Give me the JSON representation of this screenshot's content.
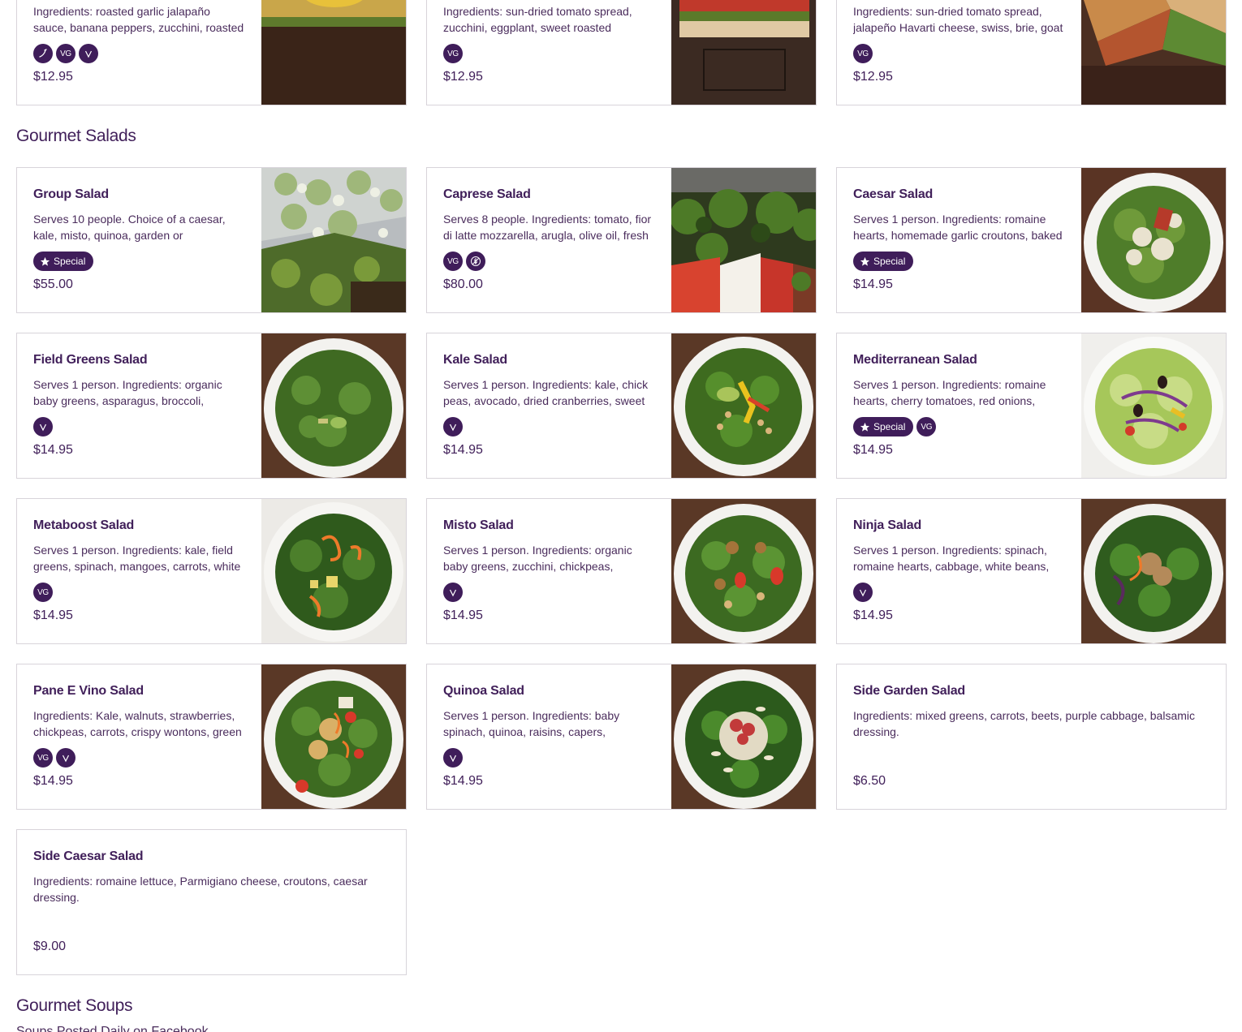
{
  "top_row": [
    {
      "desc": "Ingredients: roasted garlic jalapaño sauce, banana peppers, zucchini, roasted",
      "badges": [
        "spicy",
        "VG",
        "V"
      ],
      "price": "$12.95"
    },
    {
      "desc": "Ingredients: sun-dried tomato spread, zucchini, eggplant, sweet roasted",
      "badges": [
        "VG"
      ],
      "price": "$12.95"
    },
    {
      "desc": "Ingredients: sun-dried tomato spread, jalapeño Havarti cheese, swiss, brie, goat",
      "badges": [
        "VG"
      ],
      "price": "$12.95"
    }
  ],
  "salads_section": {
    "title": "Gourmet Salads",
    "items": [
      {
        "name": "Group Salad",
        "desc": "Serves 10 people. Choice of a caesar, kale, misto, quinoa, garden or",
        "special": "Special",
        "badges": [],
        "price": "$55.00",
        "image": "salad-trays"
      },
      {
        "name": "Caprese Salad",
        "desc": "Serves 8 people. Ingredients: tomato, fior di latte mozzarella, arugla, olive oil, fresh",
        "special": "",
        "badges": [
          "VG",
          "gluten-free"
        ],
        "price": "$80.00",
        "image": "caprese"
      },
      {
        "name": "Caesar Salad",
        "desc": "Serves 1 person. Ingredients: romaine hearts, homemade garlic croutons, baked",
        "special": "Special",
        "badges": [],
        "price": "$14.95",
        "image": "caesar"
      },
      {
        "name": "Field Greens Salad",
        "desc": "Serves 1 person. Ingredients: organic baby greens, asparagus, broccoli,",
        "special": "",
        "badges": [
          "V"
        ],
        "price": "$14.95",
        "image": "greens"
      },
      {
        "name": "Kale Salad",
        "desc": "Serves 1 person. Ingredients: kale, chick peas, avocado, dried cranberries, sweet",
        "special": "",
        "badges": [
          "V"
        ],
        "price": "$14.95",
        "image": "kale"
      },
      {
        "name": "Mediterranean Salad",
        "desc": "Serves 1 person. Ingredients: romaine hearts, cherry tomatoes, red onions,",
        "special": "Special",
        "badges": [
          "VG"
        ],
        "price": "$14.95",
        "image": "mediterranean"
      },
      {
        "name": "Metaboost Salad",
        "desc": "Serves 1 person. Ingredients: kale, field greens, spinach, mangoes, carrots, white",
        "special": "",
        "badges": [
          "VG"
        ],
        "price": "$14.95",
        "image": "metaboost"
      },
      {
        "name": "Misto Salad",
        "desc": "Serves 1 person. Ingredients: organic baby greens, zucchini, chickpeas,",
        "special": "",
        "badges": [
          "V"
        ],
        "price": "$14.95",
        "image": "misto"
      },
      {
        "name": "Ninja Salad",
        "desc": "Serves 1 person. Ingredients: spinach, romaine hearts, cabbage, white beans,",
        "special": "",
        "badges": [
          "V"
        ],
        "price": "$14.95",
        "image": "ninja"
      },
      {
        "name": "Pane E Vino Salad",
        "desc": "Ingredients: Kale, walnuts, strawberries, chickpeas, carrots, crispy wontons, green",
        "special": "",
        "badges": [
          "VG",
          "V"
        ],
        "price": "$14.95",
        "image": "panevino"
      },
      {
        "name": "Quinoa Salad",
        "desc": "Serves 1 person. Ingredients: baby spinach, quinoa, raisins, capers,",
        "special": "",
        "badges": [
          "V"
        ],
        "price": "$14.95",
        "image": "quinoa"
      },
      {
        "name": "Side Garden Salad",
        "desc": "Ingredients: mixed greens, carrots, beets, purple cabbage, balsamic dressing.",
        "special": "",
        "badges": [],
        "price": "$6.50",
        "image": ""
      },
      {
        "name": "Side Caesar Salad",
        "desc": "Ingredients: romaine lettuce, Parmigiano cheese, croutons, caesar dressing.",
        "special": "",
        "badges": [],
        "price": "$9.00",
        "image": ""
      }
    ]
  },
  "soups_section": {
    "title": "Gourmet Soups",
    "subtitle": "Soups Posted Daily on Facebook"
  },
  "colors": {
    "accent": "#3f1d5a",
    "title": "#41205a",
    "border": "#d8d4da"
  }
}
